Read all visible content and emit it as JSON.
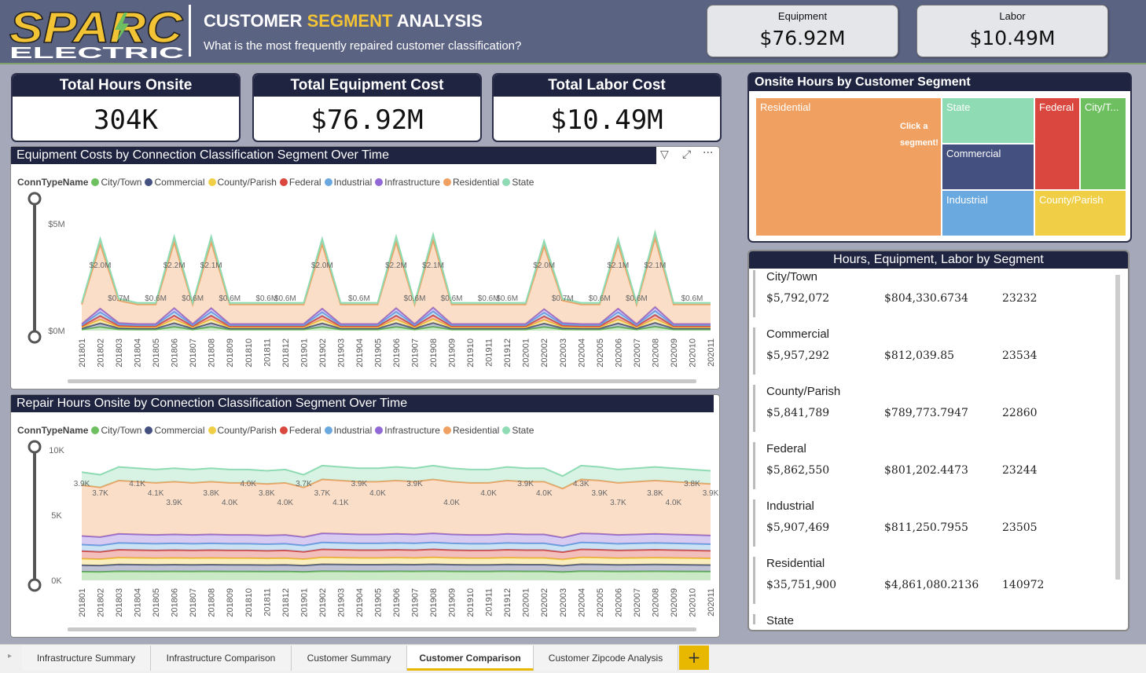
{
  "header": {
    "logo_top": "SPARC",
    "logo_bottom": "ELECTRIC",
    "title_pre": "CUSTOMER ",
    "title_hl": "SEGMENT",
    "title_post": " ANALYSIS",
    "subtitle": "What is the most frequently repaired customer classification?",
    "cards": [
      {
        "label": "Equipment",
        "value": "$76.92M"
      },
      {
        "label": "Labor",
        "value": "$10.49M"
      }
    ]
  },
  "kpis": [
    {
      "label": "Total Hours Onsite",
      "value": "304K"
    },
    {
      "label": "Total Equipment Cost",
      "value": "$76.92M"
    },
    {
      "label": "Total Labor Cost",
      "value": "$10.49M"
    }
  ],
  "legend": {
    "title": "ConnTypeName",
    "items": [
      {
        "name": "City/Town",
        "color": "#6dbf5f"
      },
      {
        "name": "Commercial",
        "color": "#44507f"
      },
      {
        "name": "County/Parish",
        "color": "#f0cf46"
      },
      {
        "name": "Federal",
        "color": "#d9473f"
      },
      {
        "name": "Industrial",
        "color": "#6aa9e0"
      },
      {
        "name": "Infrastructure",
        "color": "#9069d6"
      },
      {
        "name": "Residential",
        "color": "#f0a060"
      },
      {
        "name": "State",
        "color": "#8fdbb3"
      }
    ]
  },
  "chart_data": [
    {
      "type": "area",
      "title": "Equipment Costs by Connection Classification Segment Over Time",
      "yticks": [
        "$5M",
        "$0M"
      ],
      "ylim": [
        0,
        5
      ],
      "x": [
        "201801",
        "201802",
        "201803",
        "201804",
        "201805",
        "201806",
        "201807",
        "201808",
        "201809",
        "201810",
        "201811",
        "201812",
        "201901",
        "201902",
        "201903",
        "201904",
        "201905",
        "201906",
        "201907",
        "201908",
        "201909",
        "201910",
        "201911",
        "201912",
        "202001",
        "202002",
        "202003",
        "202004",
        "202005",
        "202006",
        "202007",
        "202008",
        "202009",
        "202010",
        "202011"
      ],
      "total_millions": [
        1.3,
        4.3,
        1.5,
        1.3,
        1.3,
        4.4,
        1.3,
        4.4,
        1.3,
        1.3,
        1.3,
        1.3,
        1.3,
        4.3,
        1.3,
        1.3,
        1.3,
        4.4,
        1.3,
        4.5,
        1.3,
        1.3,
        1.3,
        1.3,
        1.3,
        4.2,
        1.5,
        1.3,
        1.3,
        4.3,
        1.3,
        4.6,
        1.3,
        1.3,
        1.3
      ],
      "residential_labels": [
        "",
        "$2.0M",
        "$0.7M",
        "",
        "$0.6M",
        "$2.2M",
        "$0.6M",
        "$2.1M",
        "$0.6M",
        "",
        "$0.6M",
        "$0.6M",
        "",
        "$2.0M",
        "",
        "$0.6M",
        "",
        "$2.2M",
        "$0.6M",
        "$2.1M",
        "$0.6M",
        "",
        "$0.6M",
        "$0.6M",
        "",
        "$2.0M",
        "$0.7M",
        "",
        "$0.6M",
        "$2.1M",
        "$0.6M",
        "$2.1M",
        "",
        "$0.6M",
        ""
      ]
    },
    {
      "type": "area",
      "title": "Repair Hours Onsite by Connection Classification Segment Over Time",
      "yticks": [
        "10K",
        "5K",
        "0K"
      ],
      "ylim": [
        0,
        10000
      ],
      "x": [
        "201801",
        "201802",
        "201803",
        "201804",
        "201805",
        "201806",
        "201807",
        "201808",
        "201809",
        "201810",
        "201811",
        "201812",
        "201901",
        "201902",
        "201903",
        "201904",
        "201905",
        "201906",
        "201907",
        "201908",
        "201909",
        "201910",
        "201911",
        "201912",
        "202001",
        "202002",
        "202003",
        "202004",
        "202005",
        "202006",
        "202007",
        "202008",
        "202009",
        "202010",
        "202011"
      ],
      "total": [
        8300,
        8100,
        8700,
        8600,
        8500,
        8600,
        8500,
        8600,
        8500,
        8500,
        8400,
        8500,
        8100,
        8800,
        8700,
        8600,
        8600,
        8700,
        8600,
        8800,
        8600,
        8500,
        8500,
        8700,
        8600,
        8600,
        8000,
        8800,
        8700,
        8500,
        8600,
        8700,
        8600,
        8500,
        8400
      ],
      "residential_labels": [
        "3.9K",
        "3.7K",
        "",
        "4.1K",
        "4.1K",
        "3.9K",
        "",
        "3.8K",
        "4.0K",
        "4.0K",
        "3.8K",
        "4.0K",
        "3.7K",
        "3.7K",
        "4.1K",
        "3.9K",
        "4.0K",
        "",
        "3.9K",
        "",
        "4.0K",
        "",
        "4.0K",
        "",
        "3.9K",
        "4.0K",
        "",
        "4.3K",
        "3.9K",
        "3.7K",
        "",
        "3.8K",
        "4.0K",
        "3.8K",
        "3.9K"
      ]
    }
  ],
  "treemap": {
    "title": "Onsite Hours by Customer Segment",
    "hint_1": "Click a",
    "hint_2": "segment!",
    "segments": [
      {
        "name": "Residential",
        "color": "#f0a060"
      },
      {
        "name": "State",
        "color": "#8fdbb3"
      },
      {
        "name": "Federal",
        "color": "#d9473f"
      },
      {
        "name": "City/T...",
        "color": "#6dbf5f"
      },
      {
        "name": "Commercial",
        "color": "#44507f"
      },
      {
        "name": "Industrial",
        "color": "#6aa9e0"
      },
      {
        "name": "County/Parish",
        "color": "#f0cf46"
      }
    ]
  },
  "segment_table": {
    "title": "Hours, Equipment, Labor by Segment",
    "rows": [
      {
        "name": "City/Town",
        "equipment": "$5,792,072",
        "labor": "$804,330.6734",
        "hours": "23232"
      },
      {
        "name": "Commercial",
        "equipment": "$5,957,292",
        "labor": "$812,039.85",
        "hours": "23534"
      },
      {
        "name": "County/Parish",
        "equipment": "$5,841,789",
        "labor": "$789,773.7947",
        "hours": "22860"
      },
      {
        "name": "Federal",
        "equipment": "$5,862,550",
        "labor": "$801,202.4473",
        "hours": "23244"
      },
      {
        "name": "Industrial",
        "equipment": "$5,907,469",
        "labor": "$811,250.7955",
        "hours": "23505"
      },
      {
        "name": "Residential",
        "equipment": "$35,751,900",
        "labor": "$4,861,080.2136",
        "hours": "140972"
      },
      {
        "name": "State",
        "equipment": "",
        "labor": "",
        "hours": ""
      }
    ]
  },
  "tabs": [
    {
      "label": "Infrastructure Summary"
    },
    {
      "label": "Infrastructure Comparison"
    },
    {
      "label": "Customer Summary"
    },
    {
      "label": "Customer Comparison"
    },
    {
      "label": "Customer Zipcode Analysis"
    }
  ],
  "add_tab": "+"
}
